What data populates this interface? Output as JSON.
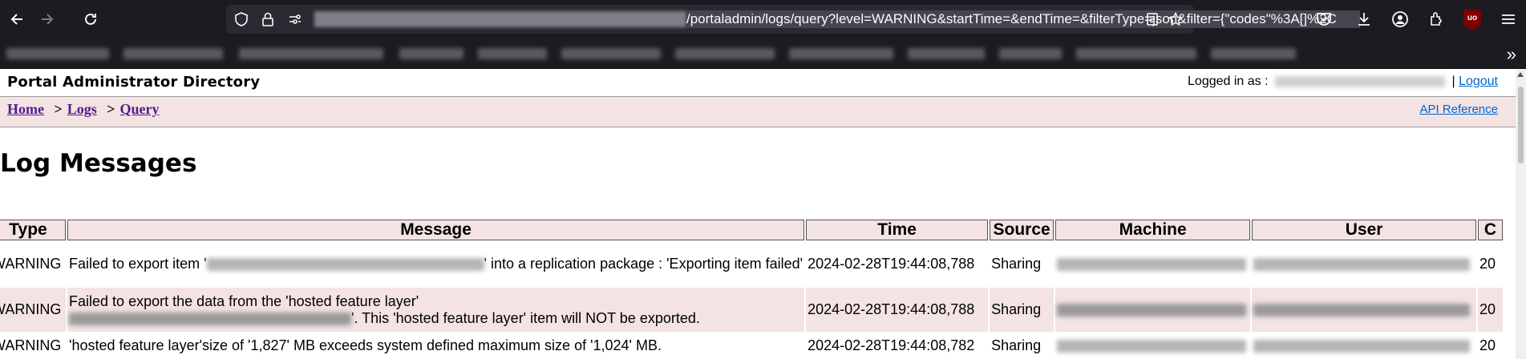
{
  "browser": {
    "url_text": "/portaladmin/logs/query?level=WARNING&startTime=&endTime=&filterType=json&filter={\"codes\"%3A[]%2C"
  },
  "page": {
    "directory_title": "Portal Administrator Directory",
    "logged_in_label": "Logged in as :",
    "separator": "|",
    "logout": "Logout",
    "breadcrumb": {
      "home": "Home",
      "logs": "Logs",
      "query": "Query",
      "sep": ">"
    },
    "api_reference": "API Reference",
    "heading": "Log Messages"
  },
  "table": {
    "headers": {
      "type": "Type",
      "message": "Message",
      "time": "Time",
      "source": "Source",
      "machine": "Machine",
      "user": "User",
      "extra": "C"
    },
    "rows": [
      {
        "type": "WARNING",
        "message_a": "Failed to export item '",
        "message_b": "' into a replication package : 'Exporting item failed'",
        "time": "2024-02-28T19:44:08,788",
        "source": "Sharing",
        "extra": "20"
      },
      {
        "type": "WARNING",
        "message_a": "Failed to export the data from the 'hosted feature layer'",
        "message_b": "'. This 'hosted feature layer' item will NOT be exported.",
        "time": "2024-02-28T19:44:08,788",
        "source": "Sharing",
        "extra": "20"
      },
      {
        "type": "WARNING",
        "message_a": "'hosted feature layer'size of '1,827' MB exceeds system defined maximum size of '1,024' MB.",
        "message_b": "",
        "time": "2024-02-28T19:44:08,782",
        "source": "Sharing",
        "extra": "20"
      }
    ]
  }
}
